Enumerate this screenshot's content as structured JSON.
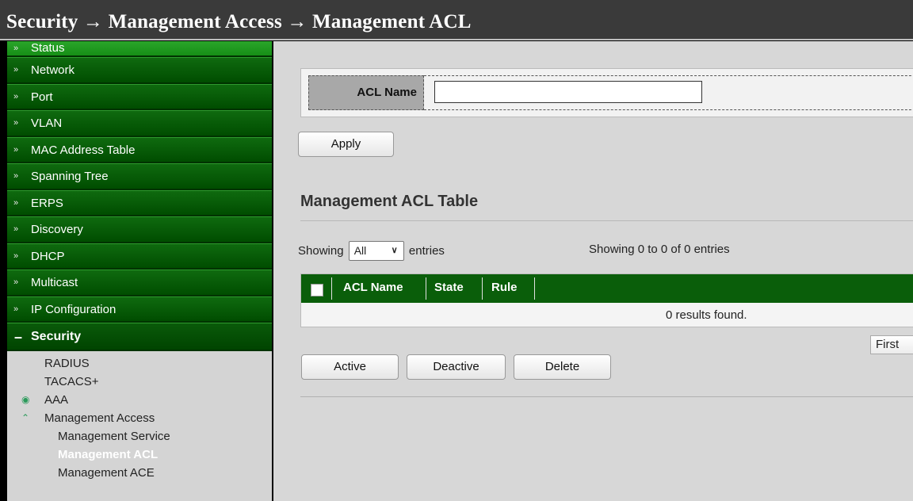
{
  "breadcrumb": {
    "text": "Security → Management Access → Management ACL"
  },
  "sidebar": {
    "menu": [
      {
        "label": "Status"
      },
      {
        "label": "Network"
      },
      {
        "label": "Port"
      },
      {
        "label": "VLAN"
      },
      {
        "label": "MAC Address Table"
      },
      {
        "label": "Spanning Tree"
      },
      {
        "label": "ERPS"
      },
      {
        "label": "Discovery"
      },
      {
        "label": "DHCP"
      },
      {
        "label": "Multicast"
      },
      {
        "label": "IP Configuration"
      },
      {
        "label": "Security"
      }
    ],
    "submenu": {
      "radius": "RADIUS",
      "tacacs": "TACACS+",
      "aaa": "AAA",
      "management_access": "Management Access",
      "management_service": "Management Service",
      "management_acl": "Management ACL",
      "management_ace": "Management ACE"
    },
    "collapsed_marker": "»",
    "expanded_marker": "–"
  },
  "form": {
    "acl_name_label": "ACL Name",
    "acl_name_value": "",
    "apply_label": "Apply"
  },
  "table_section": {
    "title": "Management ACL Table",
    "showing_prefix": "Showing",
    "entries_selected": "All",
    "entries_suffix": "entries",
    "info": "Showing 0 to 0 of 0 entries",
    "columns": [
      "ACL Name",
      "State",
      "Rule"
    ],
    "rows": [],
    "empty_message": "0 results found.",
    "first_label": "First"
  },
  "actions": {
    "active_label": "Active",
    "deactive_label": "Deactive",
    "delete_label": "Delete"
  },
  "colors": {
    "menu_green": "#0a5e0a",
    "status_green": "#1e9a1e",
    "title_bar": "#3a3a3a"
  }
}
